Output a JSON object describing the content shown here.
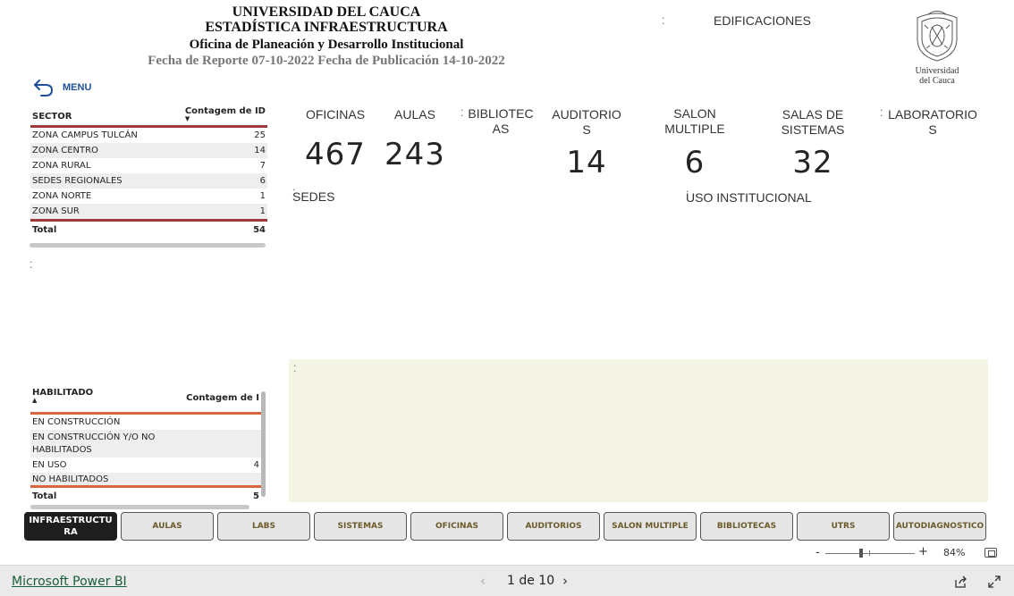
{
  "header": {
    "line1": "UNIVERSIDAD DEL CAUCA",
    "line2": "ESTADÍSTICA INFRAESTRUCTURA",
    "line3": "Oficina de Planeación y Desarrollo Institucional",
    "line4": "Fecha de Reporte 07-10-2022 Fecha de Publicación 14-10-2022",
    "page_title": "EDIFICACIONES"
  },
  "logo": {
    "text_line1": "Universidad",
    "text_line2": "del Cauca"
  },
  "menu": {
    "label": "MENU",
    "icon": "back-arrow-icon"
  },
  "sector_table": {
    "col1": "SECTOR",
    "col2": "Contagem de ID",
    "rows": [
      {
        "name": "ZONA CAMPUS TULCÁN",
        "count": "25"
      },
      {
        "name": "ZONA CENTRO",
        "count": "14"
      },
      {
        "name": "ZONA RURAL",
        "count": "7"
      },
      {
        "name": "SEDES REGIONALES",
        "count": "6"
      },
      {
        "name": "ZONA NORTE",
        "count": "1"
      },
      {
        "name": "ZONA SUR",
        "count": "1"
      }
    ],
    "total_label": "Total",
    "total_value": "54"
  },
  "habilitado_table": {
    "col1": "HABILITADO",
    "col2": "Contagem de I",
    "rows": [
      {
        "name": "EN CONSTRUCCIÓN",
        "count": ""
      },
      {
        "name": "EN CONSTRUCCIÓN Y/O NO HABILITADOS",
        "count": ""
      },
      {
        "name": "EN USO",
        "count": "4"
      },
      {
        "name": "NO HABILITADOS",
        "count": ""
      }
    ],
    "total_label": "Total",
    "total_value": "5"
  },
  "kpis": {
    "oficinas": {
      "label": "OFICINAS",
      "value": "467"
    },
    "aulas": {
      "label": "AULAS",
      "value": "243"
    },
    "bibliotecas": {
      "label1": "BIBLIOTEC",
      "label2": "AS"
    },
    "auditorios": {
      "label1": "AUDITORIO",
      "label2": "S",
      "value": "14"
    },
    "salon_multiple": {
      "label1": "SALON",
      "label2": "MULTIPLE",
      "value": "6"
    },
    "salas_sistemas": {
      "label1": "SALAS DE",
      "label2": "SISTEMAS",
      "value": "32"
    },
    "laboratorios": {
      "label1": "LABORATORIO",
      "label2": "S"
    }
  },
  "sections": {
    "sedes": "SEDES",
    "uso": "USO INSTITUCIONAL"
  },
  "tabs": [
    {
      "label": "INFRAESTRUCTURA",
      "active": true
    },
    {
      "label": "AULAS"
    },
    {
      "label": "LABS"
    },
    {
      "label": "SISTEMAS"
    },
    {
      "label": "OFICINAS"
    },
    {
      "label": "AUDITORIOS"
    },
    {
      "label": "SALON MULTIPLE"
    },
    {
      "label": "BIBLIOTECAS"
    },
    {
      "label": "UTRS"
    },
    {
      "label": "AUTODIAGNOSTICO"
    }
  ],
  "zoom": {
    "minus": "-",
    "plus": "+",
    "percent": "84%",
    "level": 0.84
  },
  "footer": {
    "link": "Microsoft Power BI",
    "page_text": "1 de 10"
  },
  "colors": {
    "sector_separator": "#9e3a3a",
    "habilitado_separator": "#d9663f",
    "active_tab": "#1e1e1e",
    "panel_beige": "#f5f5e6",
    "menu_blue": "#1f4e9c"
  }
}
